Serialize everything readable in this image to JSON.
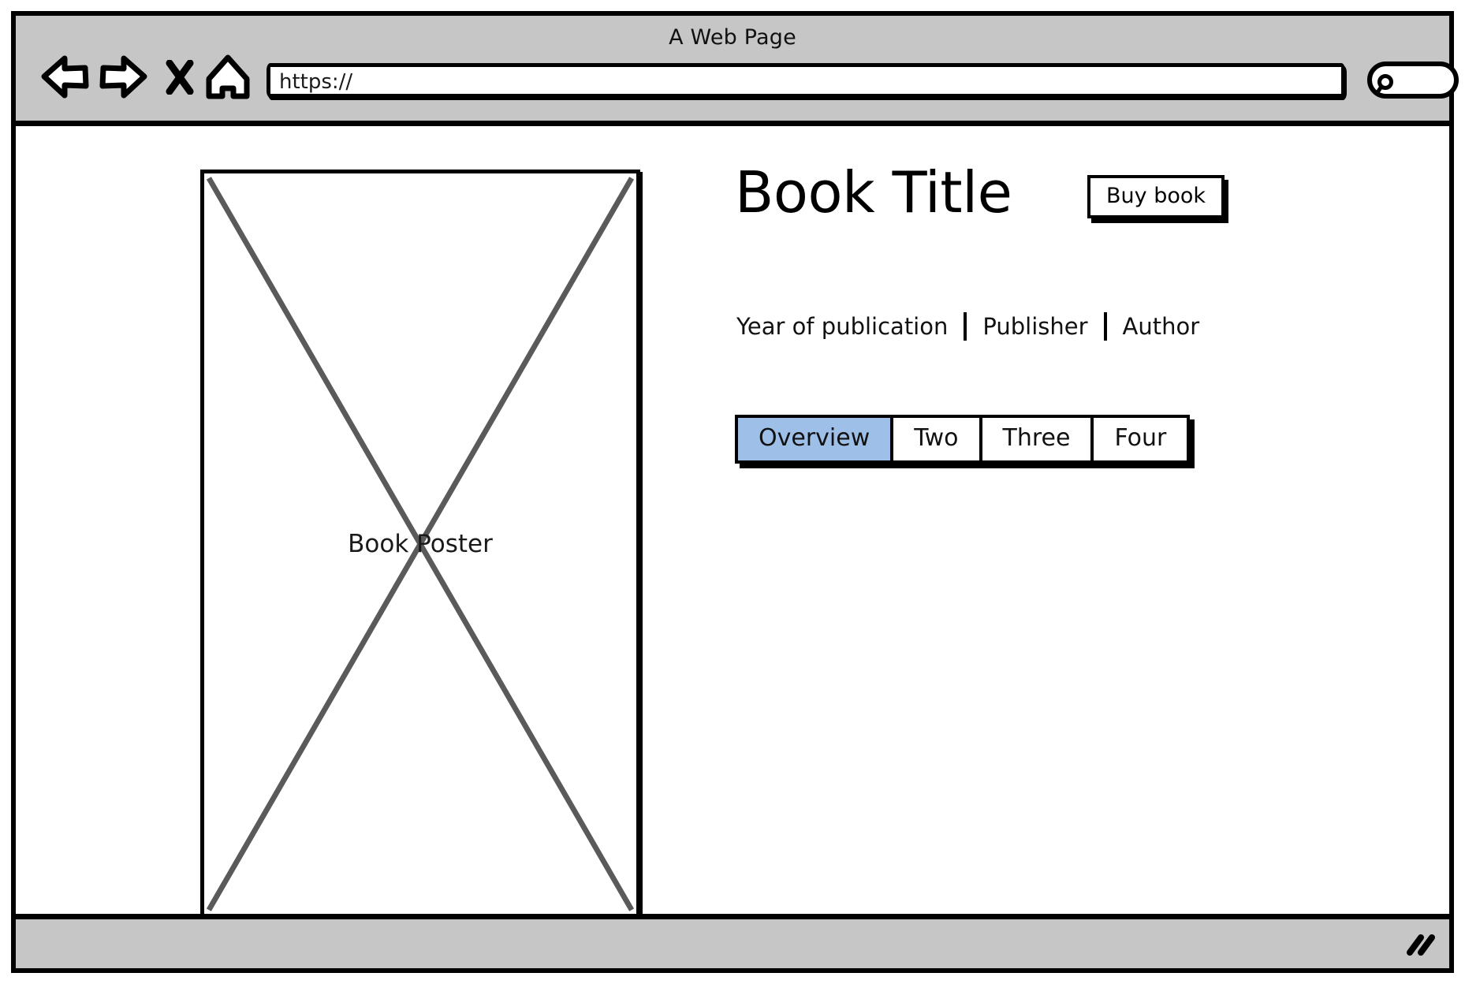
{
  "window": {
    "title": "A Web Page"
  },
  "toolbar": {
    "back_icon": "back-arrow-icon",
    "forward_icon": "forward-arrow-icon",
    "stop_icon": "stop-x-icon",
    "home_icon": "home-icon",
    "url_value": "https://",
    "url_placeholder": "https://",
    "search_icon": "search-magnifier-icon",
    "search_value": "",
    "search_placeholder": ""
  },
  "poster": {
    "label": "Book Poster",
    "line_color": "#5a5a5a",
    "border_color": "#000000"
  },
  "detail": {
    "title": "Book Title",
    "buy_label": "Buy book",
    "meta": [
      "Year of publication",
      "Publisher",
      "Author"
    ],
    "tabs": [
      {
        "label": "Overview",
        "selected": true
      },
      {
        "label": "Two",
        "selected": false
      },
      {
        "label": "Three",
        "selected": false
      },
      {
        "label": "Four",
        "selected": false
      }
    ],
    "selected_tab_color": "#9dbfe8"
  },
  "status": {
    "resize_icon": "resize-grip-icon"
  },
  "colors": {
    "chrome_gray": "#c6c6c6",
    "outline_black": "#000000",
    "page_white": "#ffffff"
  }
}
